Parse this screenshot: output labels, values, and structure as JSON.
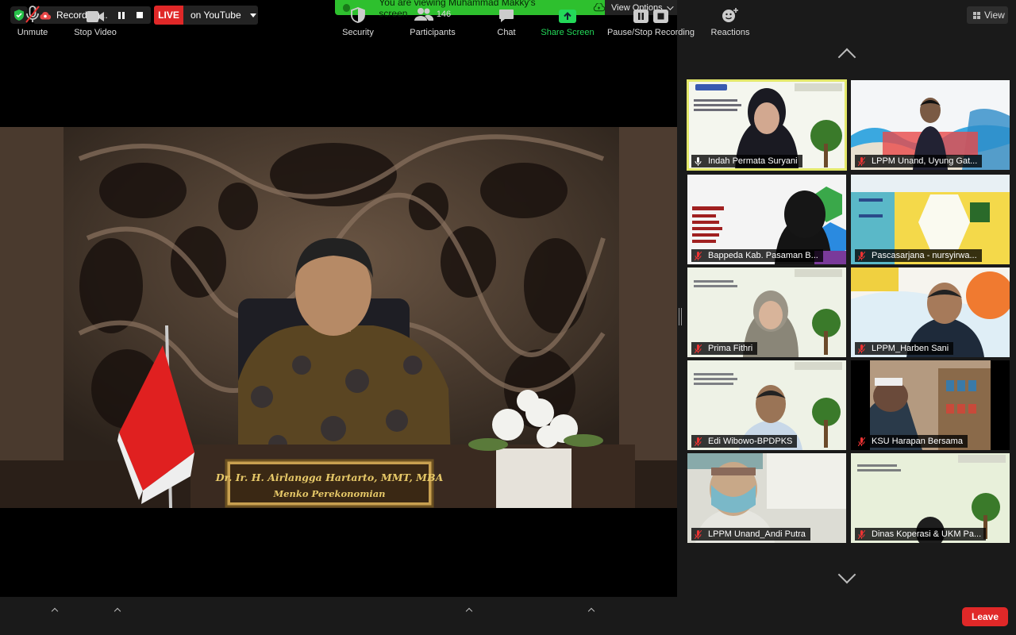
{
  "top_bar": {
    "recording_label": "Recording...",
    "live_badge": "LIVE",
    "stream_target": "on YouTube",
    "viewing_banner": "You are viewing Muhammad Makky's screen",
    "view_options_label": "View Options",
    "view_label": "View"
  },
  "main_video": {
    "nameplate_line1": "Dr. Ir. H. Airlangga Hartarto, MMT, MBA",
    "nameplate_line2": "Menko Perekonomian"
  },
  "participants_gallery": [
    {
      "name": "Indah Permata Suryani",
      "active_speaker": true
    },
    {
      "name": "LPPM Unand, Uyung Gat..."
    },
    {
      "name": "Bappeda Kab. Pasaman B..."
    },
    {
      "name": "Pascasarjana - nursyirwa..."
    },
    {
      "name": "Prima Fithri"
    },
    {
      "name": "LPPM_Harben Sani"
    },
    {
      "name": "Edi Wibowo-BPDPKS"
    },
    {
      "name": "KSU Harapan Bersama"
    },
    {
      "name": "LPPM Unand_Andi Putra"
    },
    {
      "name": "Dinas Koperasi & UKM Pa..."
    }
  ],
  "toolbar": {
    "unmute": "Unmute",
    "stop_video": "Stop Video",
    "security": "Security",
    "participants": "Participants",
    "participants_count": "146",
    "chat": "Chat",
    "share_screen": "Share Screen",
    "pause_stop_recording": "Pause/Stop Recording",
    "reactions": "Reactions",
    "leave": "Leave"
  },
  "colors": {
    "live_red": "#e02828",
    "banner_green": "#2ec02e",
    "share_green": "#23d959",
    "active_speaker_border": "#e3e86a"
  }
}
